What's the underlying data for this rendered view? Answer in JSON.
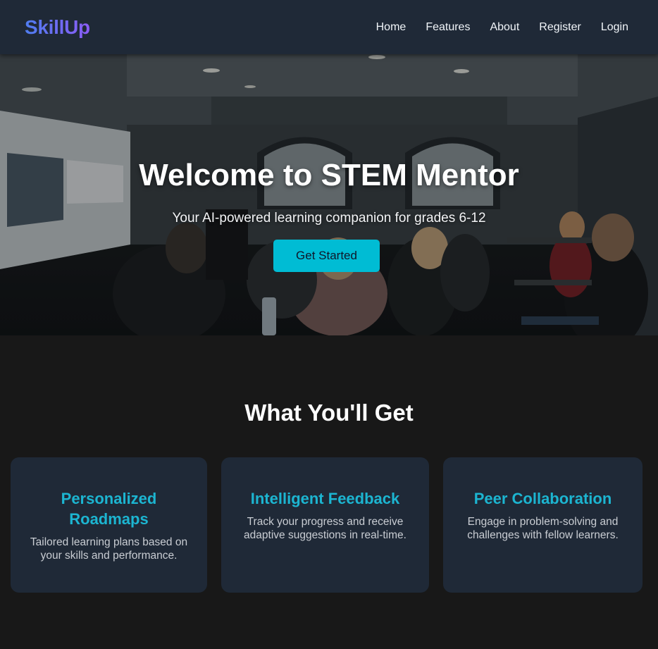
{
  "navbar": {
    "brand": "SkillUp",
    "links": [
      {
        "label": "Home"
      },
      {
        "label": "Features"
      },
      {
        "label": "About"
      },
      {
        "label": "Register"
      },
      {
        "label": "Login"
      }
    ]
  },
  "hero": {
    "title": "Welcome to STEM Mentor",
    "subtitle": "Your AI-powered learning companion for grades 6-12",
    "cta_label": "Get Started"
  },
  "features": {
    "title": "What You'll Get",
    "cards": [
      {
        "title": "Personalized Roadmaps",
        "description": "Tailored learning plans based on your skills and performance."
      },
      {
        "title": "Intelligent Feedback",
        "description": "Track your progress and receive adaptive suggestions in real-time."
      },
      {
        "title": "Peer Collaboration",
        "description": "Engage in problem-solving and challenges with fellow learners."
      }
    ]
  },
  "colors": {
    "navbar_bg": "#1f2937",
    "page_bg": "#181818",
    "accent": "#00bcd4",
    "card_title": "#1cb5d1",
    "brand_gradient_start": "#4f7df0",
    "brand_gradient_end": "#8b5cf6"
  }
}
